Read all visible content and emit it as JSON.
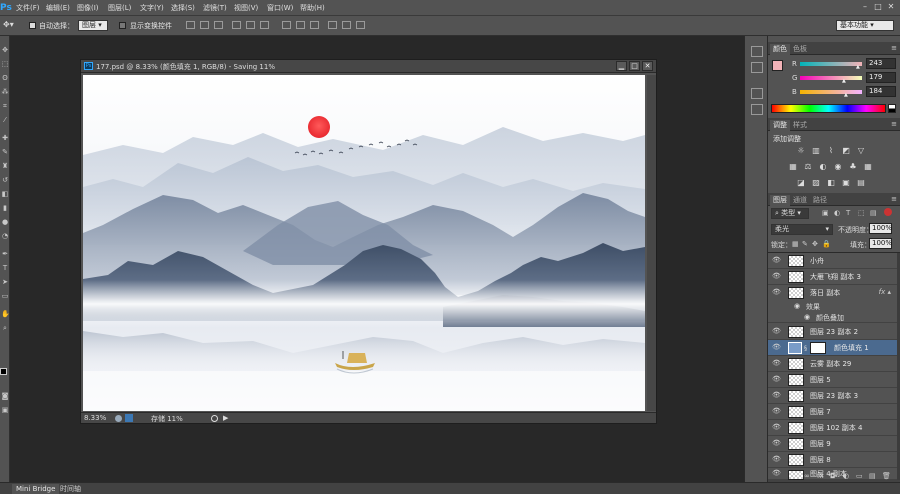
{
  "app": {
    "logo": "Ps"
  },
  "menubar": {
    "items": [
      "文件(F)",
      "编辑(E)",
      "图像(I)",
      "图层(L)",
      "文字(Y)",
      "选择(S)",
      "滤镜(T)",
      "视图(V)",
      "窗口(W)",
      "帮助(H)"
    ],
    "window_controls": [
      "–",
      "□",
      "✕"
    ]
  },
  "optionsbar": {
    "auto_select_label": "自动选择：",
    "auto_select_target": "图层",
    "show_transform_label": "显示变换控件",
    "workspace": "基本功能"
  },
  "document": {
    "title": "177.psd @ 8.33% (颜色填充 1, RGB/8) - Saving 11%",
    "controls": [
      "▁",
      "□",
      "✕"
    ],
    "status": {
      "zoom": "8.33%",
      "save_label": "存储 11%"
    }
  },
  "bottom_tabs": [
    "Mini Bridge",
    "时间轴"
  ],
  "color_panel": {
    "tabs": [
      "颜色",
      "色板"
    ],
    "swatch_color": "#f3b3b8",
    "channels": [
      {
        "label": "R",
        "value": "243"
      },
      {
        "label": "G",
        "value": "179"
      },
      {
        "label": "B",
        "value": "184"
      }
    ]
  },
  "adjust_panel": {
    "tabs": [
      "调整",
      "样式"
    ],
    "title": "添加调整"
  },
  "layers_panel": {
    "tabs": [
      "图层",
      "通道",
      "路径"
    ],
    "filter_label": "类型",
    "blend_mode": "柔光",
    "opacity_label": "不透明度：",
    "opacity_value": "100%",
    "lock_label": "锁定：",
    "fill_label": "填充：",
    "fill_value": "100%",
    "layers": [
      {
        "name": "小舟",
        "fx": false
      },
      {
        "name": "大雁飞翔 副本 3",
        "fx": false
      },
      {
        "name": "落日 副本",
        "fx": true
      },
      {
        "name": "图层 23 副本 2",
        "fx": false
      },
      {
        "name": "颜色填充 1",
        "fx": false,
        "selected": true
      },
      {
        "name": "云雾 副本 29",
        "fx": false
      },
      {
        "name": "图层 5",
        "fx": false
      },
      {
        "name": "图层 23 副本 3",
        "fx": false
      },
      {
        "name": "图层 7",
        "fx": false
      },
      {
        "name": "图层 102 副本 4",
        "fx": false
      },
      {
        "name": "图层 9",
        "fx": false
      },
      {
        "name": "图层 8",
        "fx": false
      },
      {
        "name": "图层 4 副本",
        "fx": false
      }
    ],
    "effects_label": "效果",
    "effect_item": "颜色叠加",
    "footer_icons": [
      "∞",
      "fx",
      "◘",
      "◐",
      "▭",
      "▤",
      "🗑"
    ]
  }
}
